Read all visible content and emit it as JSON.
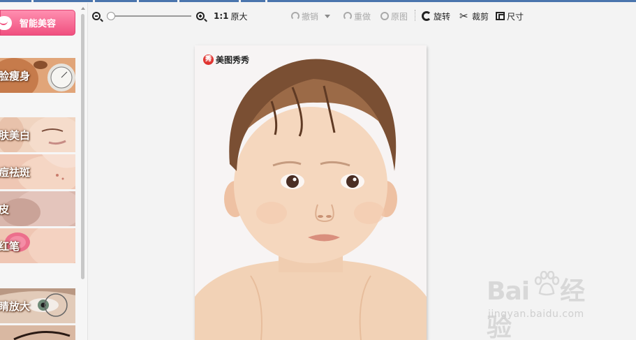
{
  "sidebar": {
    "smart_button": "智能美容",
    "items": [
      {
        "label": "脸瘦身"
      },
      {
        "label": "肤美白"
      },
      {
        "label": "痘祛斑"
      },
      {
        "label": "皮"
      },
      {
        "label": "红笔"
      },
      {
        "label": "睛放大"
      }
    ]
  },
  "toolbar": {
    "zoom_out_icon": "zoom-out-icon",
    "zoom_in_icon": "zoom-in-icon",
    "ratio_label": "1:1",
    "original_size": "原大",
    "undo": "撤销",
    "redo": "重做",
    "original_image": "原图",
    "rotate": "旋转",
    "crop": "裁剪",
    "size": "尺寸"
  },
  "canvas": {
    "watermark": "美图秀秀",
    "logo_char": "秀"
  },
  "baidu_watermark": {
    "logo_left": "Bai",
    "logo_right": "经验",
    "url": "jingyan.baidu.com"
  },
  "colors": {
    "accent": "#f0507f",
    "tab_strip": "#4a75ad",
    "background": "#f3f3f3"
  }
}
